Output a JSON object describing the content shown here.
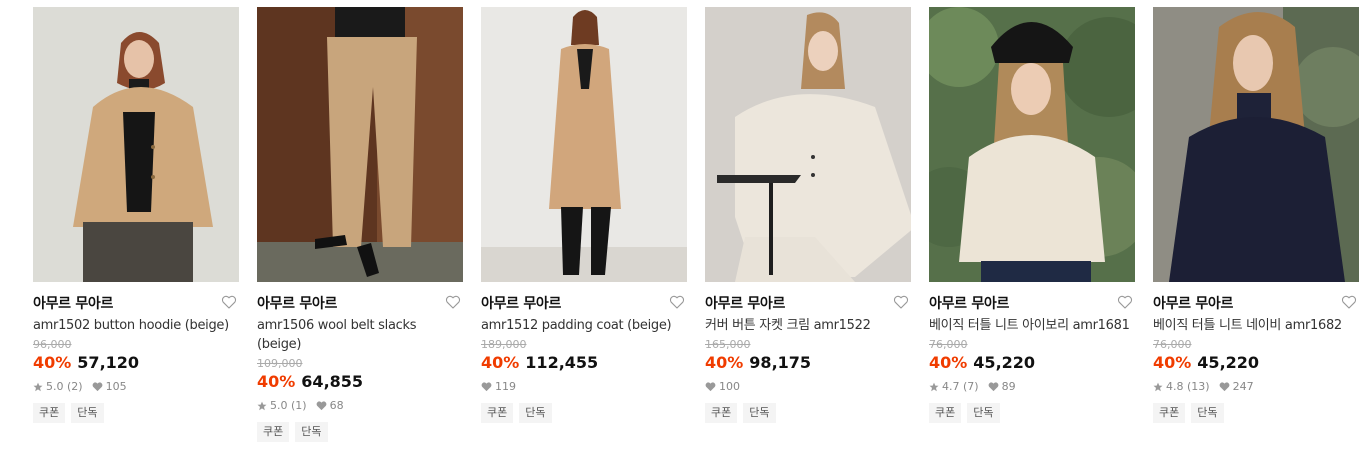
{
  "products": [
    {
      "brand": "아무르 무아르",
      "name": "amr1502 button hoodie (beige)",
      "original_price": "96,000",
      "discount": "40%",
      "price": "57,120",
      "rating": "5.0",
      "reviews": "(2)",
      "likes": "105",
      "tags": [
        "쿠폰",
        "단독"
      ]
    },
    {
      "brand": "아무르 무아르",
      "name": "amr1506 wool belt slacks (beige)",
      "original_price": "109,000",
      "discount": "40%",
      "price": "64,855",
      "rating": "5.0",
      "reviews": "(1)",
      "likes": "68",
      "tags": [
        "쿠폰",
        "단독"
      ]
    },
    {
      "brand": "아무르 무아르",
      "name": "amr1512 padding coat (beige)",
      "original_price": "189,000",
      "discount": "40%",
      "price": "112,455",
      "likes": "119",
      "tags": [
        "쿠폰",
        "단독"
      ]
    },
    {
      "brand": "아무르 무아르",
      "name": "커버 버튼 자켓 크림 amr1522",
      "original_price": "165,000",
      "discount": "40%",
      "price": "98,175",
      "likes": "100",
      "tags": [
        "쿠폰",
        "단독"
      ]
    },
    {
      "brand": "아무르 무아르",
      "name": "베이직 터틀 니트 아이보리 amr1681",
      "original_price": "76,000",
      "discount": "40%",
      "price": "45,220",
      "rating": "4.7",
      "reviews": "(7)",
      "likes": "89",
      "tags": [
        "쿠폰",
        "단독"
      ]
    },
    {
      "brand": "아무르 무아르",
      "name": "베이직 터틀 니트 네이비 amr1682",
      "original_price": "76,000",
      "discount": "40%",
      "price": "45,220",
      "rating": "4.8",
      "reviews": "(13)",
      "likes": "247",
      "tags": [
        "쿠폰",
        "단독"
      ]
    }
  ],
  "colors": {
    "discount": "#f03c00",
    "tag_bg": "#f4f4f4",
    "meta_text": "#888888"
  },
  "icons": {
    "heart": "heart-outline-icon",
    "star": "star-icon",
    "like": "heart-filled-icon"
  }
}
